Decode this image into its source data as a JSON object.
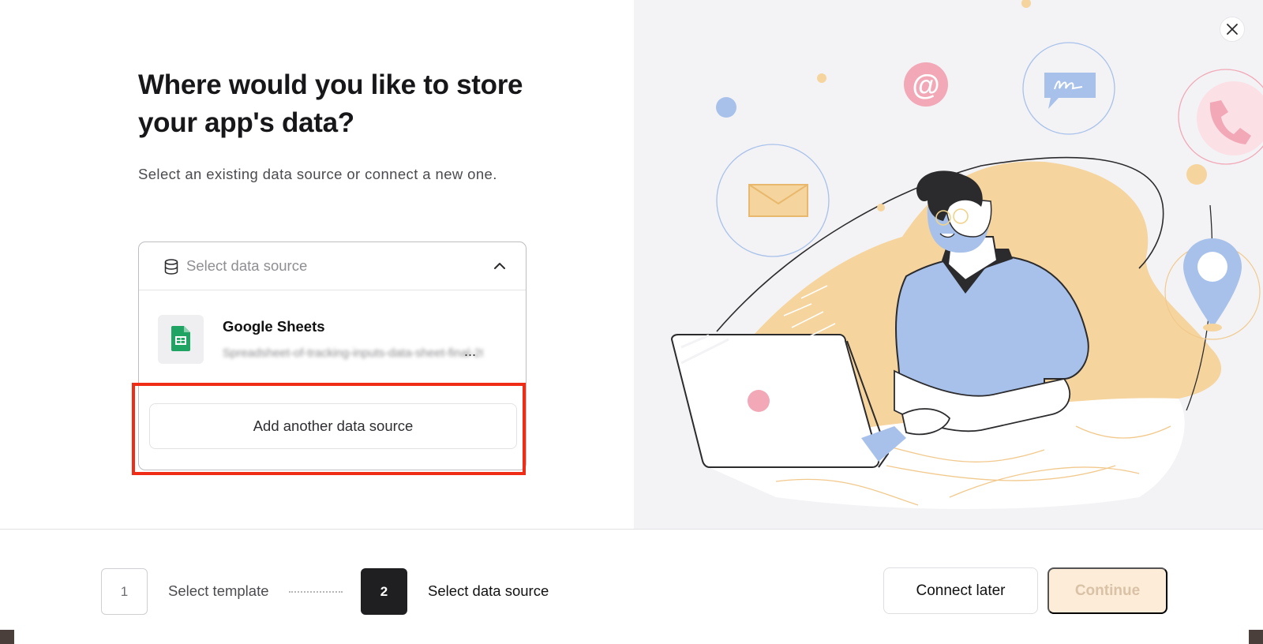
{
  "header": {
    "title": "Where would you like to store your app's data?",
    "subtitle": "Select an existing data source or connect a new one."
  },
  "data_source_select": {
    "placeholder": "Select data source",
    "icon": "database-icon",
    "expanded": true,
    "options": [
      {
        "name": "Google Sheets",
        "icon": "google-sheets-icon",
        "detail": "Spreadsheet-of-tracking-inputs-data-sheet-final-2023",
        "ellipsis": "..."
      }
    ],
    "add_label": "Add another data source"
  },
  "close_label": "close-icon",
  "stepper": {
    "steps": [
      {
        "number": "1",
        "label": "Select template",
        "active": false
      },
      {
        "number": "2",
        "label": "Select data source",
        "active": true
      }
    ]
  },
  "actions": {
    "connect_later": "Connect later",
    "continue": "Continue"
  },
  "colors": {
    "highlight": "#ef2d17",
    "illustration_bg": "#f3f3f6",
    "shirt": "#a8c1ea",
    "blob": "#f5d49e",
    "continue_bg": "#fcecd8",
    "sheets_green": "#1fa463"
  }
}
